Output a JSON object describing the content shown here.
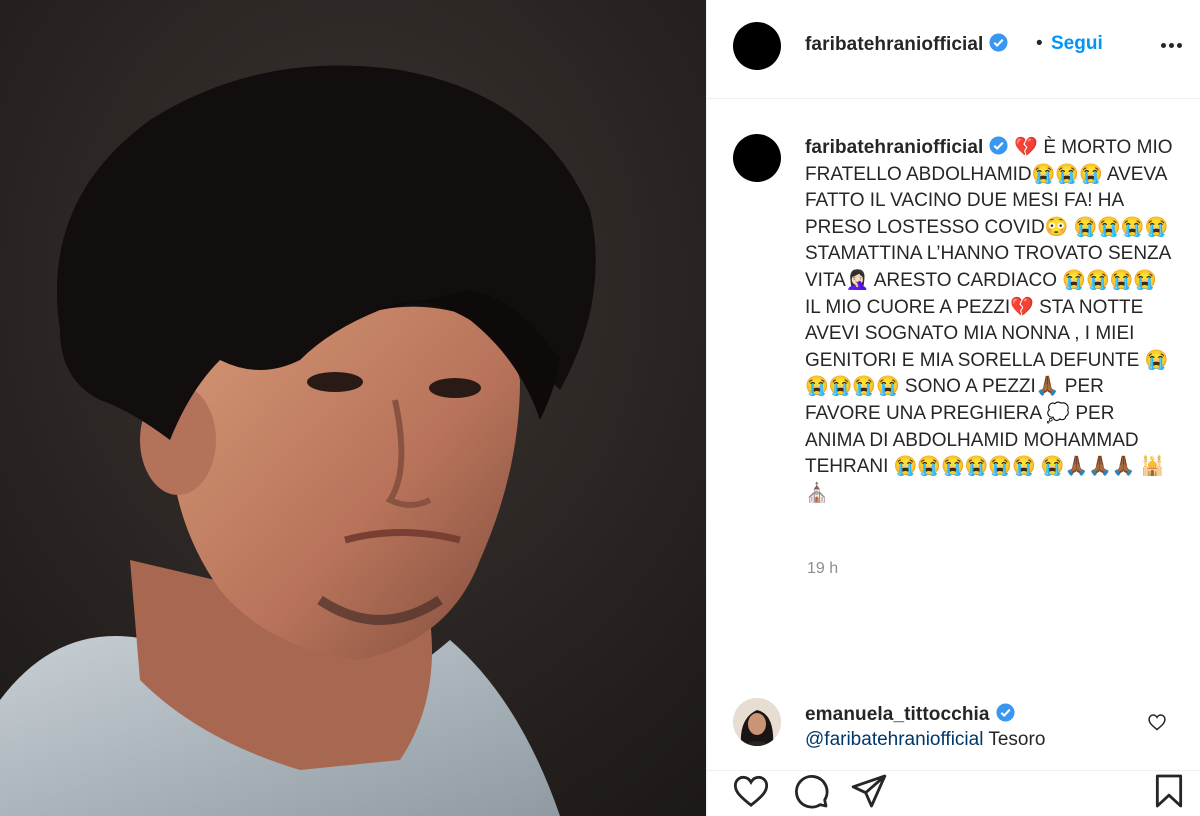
{
  "post": {
    "username": "faribatehraniofficial",
    "follow_label": "Segui",
    "separator": "•",
    "caption": "💔 È MORTO MIO FRATELLO ABDOLHAMID😭😭😭 AVEVA FATTO IL VACINO DUE MESI FA! HA PRESO LOSTESSO COVID😳 😭😭😭😭 STAMATTINA L’HANNO TROVATO SENZA VITA🤦🏻‍♀️ ARESTO CARDIACO 😭😭😭😭 IL MIO CUORE A PEZZI💔 STA NOTTE AVEVI SOGNATO MIA NONNA , I MIEI GENITORI E MIA SORELLA DEFUNTE 😭😭😭😭😭 SONO A PEZZI🙏🏾 PER FAVORE UNA PREGHIERA 💭 PER ANIMA DI ABDOLHAMID MOHAMMAD TEHRANI 😭😭😭😭😭😭 😭🙏🏾🙏🏾🙏🏾 🕌⛪",
    "time": "19 h"
  },
  "comment": {
    "username": "emanuela_tittocchia",
    "mention": "@faribatehraniofficial",
    "text": " Tesoro"
  },
  "icons": {
    "verified": "verified-badge-icon",
    "more": "more-options-icon",
    "like": "heart-icon",
    "comment": "comment-icon",
    "share": "share-icon",
    "save": "bookmark-icon"
  },
  "colors": {
    "accent": "#0095f6",
    "text": "#262626",
    "muted": "#8e8e8e",
    "mention": "#00376b",
    "verified": "#3897f0"
  }
}
